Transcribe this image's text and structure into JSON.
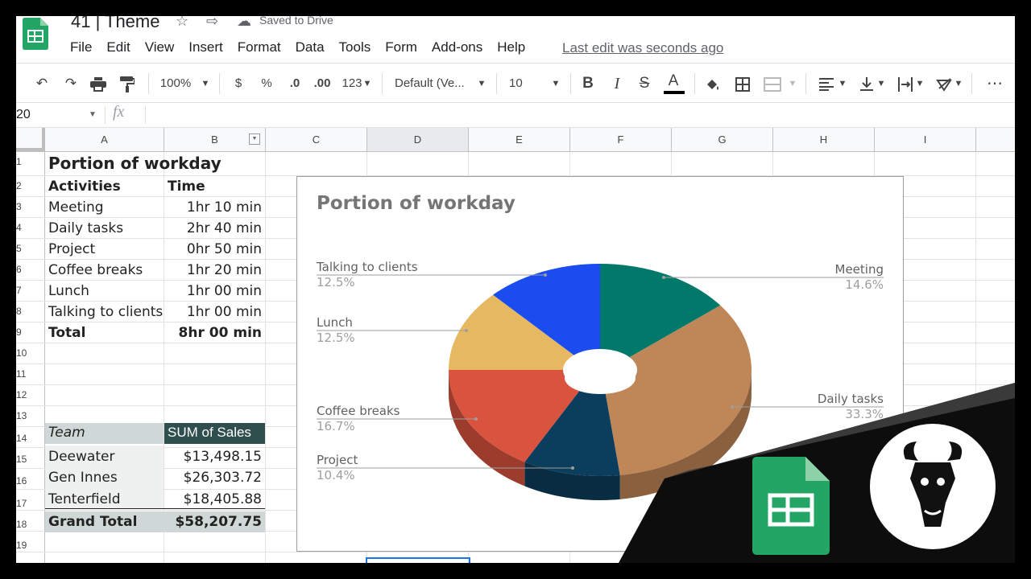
{
  "app": {
    "doc_title": "41 | Theme",
    "saved_status": "Saved to Drive",
    "last_edit": "Last edit was seconds ago",
    "menu": [
      "File",
      "Edit",
      "View",
      "Insert",
      "Format",
      "Data",
      "Tools",
      "Form",
      "Add-ons",
      "Help"
    ]
  },
  "toolbar": {
    "zoom": "100%",
    "currency": "$",
    "percent": "%",
    "dec_less": ".0",
    "dec_more": ".00",
    "more_formats": "123",
    "font": "Default (Ve...",
    "font_size": "10",
    "bold": "B",
    "italic": "I",
    "strike": "S",
    "text_color": "A",
    "more": "⋯"
  },
  "formula_bar": {
    "name_box": "20",
    "fx": "fx"
  },
  "columns": [
    "A",
    "B",
    "C",
    "D",
    "E",
    "F",
    "G",
    "H",
    "I"
  ],
  "rows": [
    "1",
    "2",
    "3",
    "4",
    "5",
    "6",
    "7",
    "8",
    "9",
    "10",
    "11",
    "12",
    "13",
    "14",
    "15",
    "16",
    "17",
    "18",
    "19"
  ],
  "sheet": {
    "title": "Portion of workday",
    "header_activities": "Activities",
    "header_time": "Time",
    "activities": [
      {
        "name": "Meeting",
        "time": "1hr 10 min"
      },
      {
        "name": "Daily tasks",
        "time": "2hr 40 min"
      },
      {
        "name": "Project",
        "time": "0hr 50 min"
      },
      {
        "name": "Coffee breaks",
        "time": "1hr 20 min"
      },
      {
        "name": "Lunch",
        "time": "1hr 00 min"
      },
      {
        "name": "Talking to clients",
        "time": "1hr 00 min"
      }
    ],
    "total_label": "Total",
    "total_value": "8hr 00 min",
    "pivot_header_team": "Team",
    "pivot_header_sales": "SUM of Sales",
    "pivot_rows": [
      {
        "team": "Deewater",
        "sales": "$13,498.15"
      },
      {
        "team": "Gen Innes",
        "sales": "$26,303.72"
      },
      {
        "team": "Tenterfield",
        "sales": "$18,405.88"
      }
    ],
    "grand_total_label": "Grand Total",
    "grand_total_value": "$58,207.75"
  },
  "chart_data": {
    "type": "pie",
    "title": "Portion of workday",
    "style": "3d-donut",
    "slices": [
      {
        "name": "Meeting",
        "value": 14.6,
        "label": "14.6%",
        "color": "#00796b"
      },
      {
        "name": "Daily tasks",
        "value": 33.3,
        "label": "33.3%",
        "color": "#bf8658"
      },
      {
        "name": "Project",
        "value": 10.4,
        "label": "10.4%",
        "color": "#0b3d5c"
      },
      {
        "name": "Coffee breaks",
        "value": 16.7,
        "label": "16.7%",
        "color": "#d9533f"
      },
      {
        "name": "Lunch",
        "value": 12.5,
        "label": "12.5%",
        "color": "#e6b862"
      },
      {
        "name": "Talking to clients",
        "value": 12.5,
        "label": "12.5%",
        "color": "#1a4cf0"
      }
    ]
  },
  "colors": {
    "pivot_header": "#2f4f4f",
    "pivot_team_header": "#cfd8d6",
    "sheets_green": "#23a566"
  }
}
